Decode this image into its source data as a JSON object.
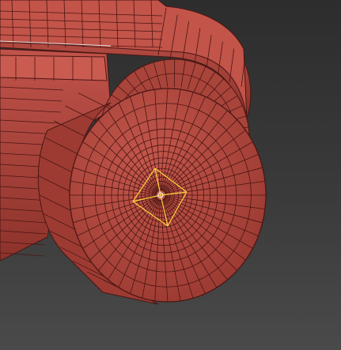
{
  "viewport": {
    "background_top": "#2d2d2d",
    "background_bottom": "#4a4a4a"
  },
  "model": {
    "fill_color": "#b5483f",
    "dark_fill_color": "#8f342d",
    "wire_color": "#4a1612",
    "selection_color": "#ffd23a",
    "edge_highlight": "#e7dede"
  }
}
